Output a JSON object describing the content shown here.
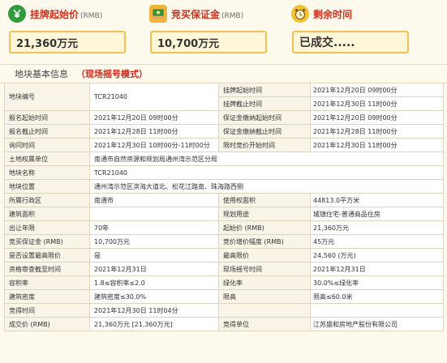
{
  "cards": [
    {
      "title": "挂牌起始价",
      "unit": "(RMB)",
      "value": "21,360万元",
      "icon": "rmb-tag-icon",
      "color": "#2f9b3d"
    },
    {
      "title": "竞买保证金",
      "unit": "(RMB)",
      "value": "10,700万元",
      "icon": "money-hand-icon",
      "color": "#f0b43a"
    },
    {
      "title": "剩余时间",
      "unit": "",
      "value": "已成交.....",
      "icon": "alarm-clock-icon",
      "color": "#f2c233"
    }
  ],
  "section": {
    "title": "地块基本信息",
    "mode": "（现场摇号模式）"
  },
  "rows": [
    {
      "type": "rs",
      "k": "地块编号",
      "v": "TCR21040",
      "k2": "挂牌起始时间",
      "v2": "2021年12月20日 09时00分"
    },
    {
      "type": "rs2",
      "k2": "挂牌截止时间",
      "v2": "2021年12月30日 11时00分"
    },
    {
      "type": "r4",
      "k": "报名起始时间",
      "v": "2021年12月20日 09时00分",
      "k2": "保证金缴纳起始时间",
      "v2": "2021年12月20日 09时00分"
    },
    {
      "type": "r4",
      "k": "报名截止时间",
      "v": "2021年12月28日 11时00分",
      "k2": "保证金缴纳截止时间",
      "v2": "2021年12月28日 11时00分"
    },
    {
      "type": "r4",
      "k": "询问时间",
      "v": "2021年12月30日 10时00分-11时00分",
      "k2": "限时竞价开始时间",
      "v2": "2021年12月30日 11时00分"
    },
    {
      "type": "r2",
      "k": "土地权属单位",
      "v": "南通市自然资源和规划局通州湾示范区分局"
    },
    {
      "type": "r2",
      "k": "地块名称",
      "v": "TCR21040"
    },
    {
      "type": "r2",
      "k": "地块位置",
      "v": "通州湾示范区滨海大道北、松花江路南、珠海路西侧"
    },
    {
      "type": "r4",
      "k": "所属行政区",
      "v": "南通市",
      "k2": "使用权面积",
      "v2": "44813.0平方米"
    },
    {
      "type": "r4",
      "k": "建筑面积",
      "v": "",
      "k2": "规划用途",
      "v2": "城镇住宅-普通商品住房"
    },
    {
      "type": "r4",
      "k": "出让年限",
      "v": "70年",
      "k2": "起始价 (RMB)",
      "v2": "21,360万元"
    },
    {
      "type": "r4",
      "k": "竞买保证金 (RMB)",
      "v": "10,700万元",
      "k2": "竞价增价幅度 (RMB)",
      "v2": "45万元"
    },
    {
      "type": "r4",
      "k": "是否设置最高限价",
      "v": "是",
      "k2": "最高限价",
      "v2": "24,560 (万元)"
    },
    {
      "type": "r4",
      "k": "资格审查截至时间",
      "v": "2021年12月31日",
      "k2": "现场摇号时间",
      "v2": "2021年12月31日"
    },
    {
      "type": "r4",
      "k": "容积率",
      "v": "1.8≤容积率≤2.0",
      "k2": "绿化率",
      "v2": "30.0%≤绿化率"
    },
    {
      "type": "r4",
      "k": "建筑密度",
      "v": "建筑密度≤30.0%",
      "k2": "限高",
      "v2": "限高≤60.0米"
    },
    {
      "type": "r4",
      "k": "竞得时间",
      "v": "2021年12月30日 11时04分",
      "k2": "",
      "v2": ""
    },
    {
      "type": "r4",
      "k": "成交价 (RMB)",
      "v": "21,360万元 [21,360万元]",
      "k2": "竞得单位",
      "v2": "江苏盛和房地产股份有限公司"
    }
  ]
}
